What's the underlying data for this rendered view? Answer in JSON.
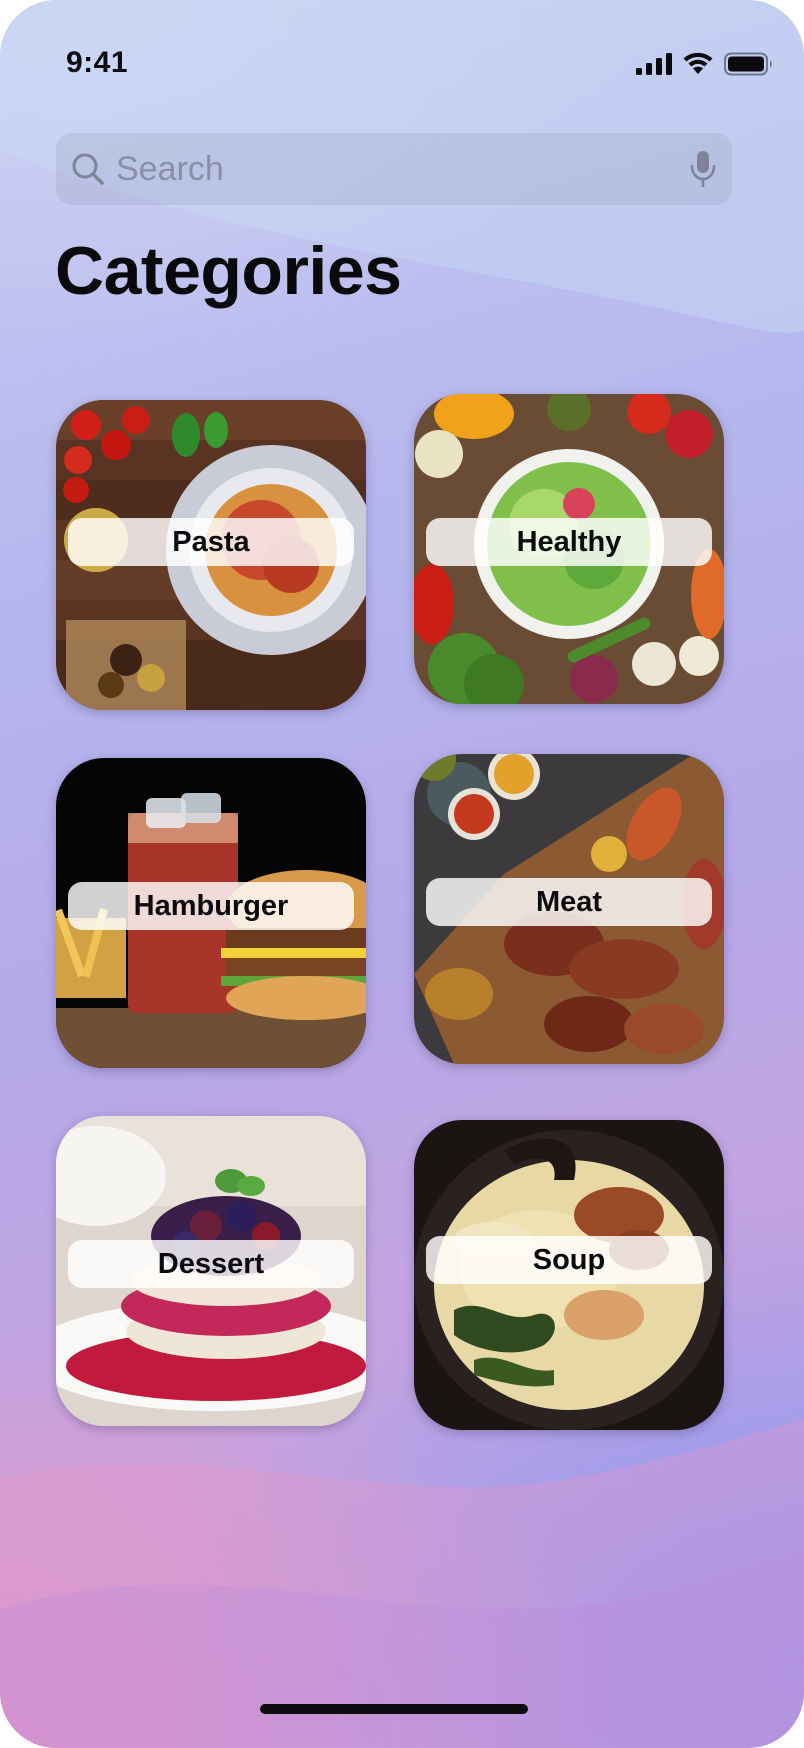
{
  "status_bar": {
    "time": "9:41"
  },
  "search": {
    "placeholder": "Search"
  },
  "page": {
    "title": "Categories"
  },
  "categories": [
    {
      "label": "Pasta"
    },
    {
      "label": "Healthy"
    },
    {
      "label": "Hamburger"
    },
    {
      "label": "Meat"
    },
    {
      "label": "Dessert"
    },
    {
      "label": "Soup"
    }
  ],
  "icons": {
    "search": "search-icon",
    "mic": "mic-icon",
    "signal": "cellular-signal-icon",
    "wifi": "wifi-icon",
    "battery": "battery-icon"
  },
  "colors": {
    "title_text": "#0a0a0c",
    "label_background": "#ffffff",
    "placeholder_text": "#8a8ea6"
  }
}
